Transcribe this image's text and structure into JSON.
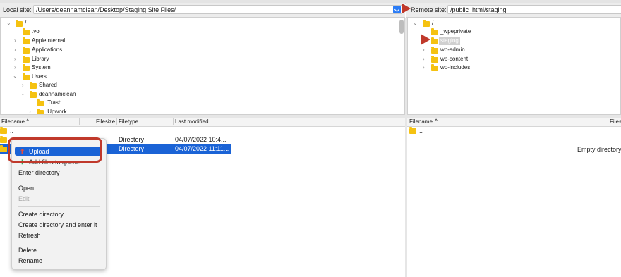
{
  "local": {
    "site_label": "Local site:",
    "path": "/Users/deannamclean/Desktop/Staging Site Files/",
    "tree": [
      {
        "label": "/",
        "expanded": true
      },
      {
        "label": ".vol"
      },
      {
        "label": "AppleInternal"
      },
      {
        "label": "Applications"
      },
      {
        "label": "Library"
      },
      {
        "label": "System"
      },
      {
        "label": "Users",
        "expanded": true
      },
      {
        "label": "Shared"
      },
      {
        "label": "deannamclean",
        "expanded": true
      },
      {
        "label": ".Trash"
      },
      {
        "label": ".Upwork"
      }
    ],
    "columns": {
      "filename": "Filename",
      "filesize": "Filesize",
      "filetype": "Filetype",
      "last_modified": "Last modified"
    },
    "rows": [
      {
        "name": "..",
        "type": "",
        "modified": ""
      },
      {
        "name": "",
        "type": "Directory",
        "modified": "04/07/2022 10:4..."
      },
      {
        "name": "",
        "type": "Directory",
        "modified": "04/07/2022 11:11..."
      }
    ]
  },
  "remote": {
    "site_label": "Remote site:",
    "path": "/public_html/staging",
    "tree": [
      {
        "label": "/",
        "expanded": true
      },
      {
        "label": "_wpeprivate"
      },
      {
        "label": "staging",
        "selected": true
      },
      {
        "label": "wp-admin"
      },
      {
        "label": "wp-content"
      },
      {
        "label": "wp-includes"
      }
    ],
    "columns": {
      "filename": "Filename",
      "filesize": "Files"
    },
    "rows": [
      {
        "name": ".."
      }
    ],
    "empty_text": "Empty directory"
  },
  "context_menu": {
    "items": [
      {
        "label": "Upload",
        "highlighted": true
      },
      {
        "label": "Add files to queue"
      },
      {
        "label": "Enter directory"
      },
      {
        "label": "Open"
      },
      {
        "label": "Edit",
        "disabled": true
      },
      {
        "label": "Create directory"
      },
      {
        "label": "Create directory and enter it"
      },
      {
        "label": "Refresh"
      },
      {
        "label": "Delete"
      },
      {
        "label": "Rename"
      }
    ]
  },
  "colors": {
    "selection": "#1a63d6",
    "folder": "#f5c211",
    "annotation": "#c0392b"
  }
}
